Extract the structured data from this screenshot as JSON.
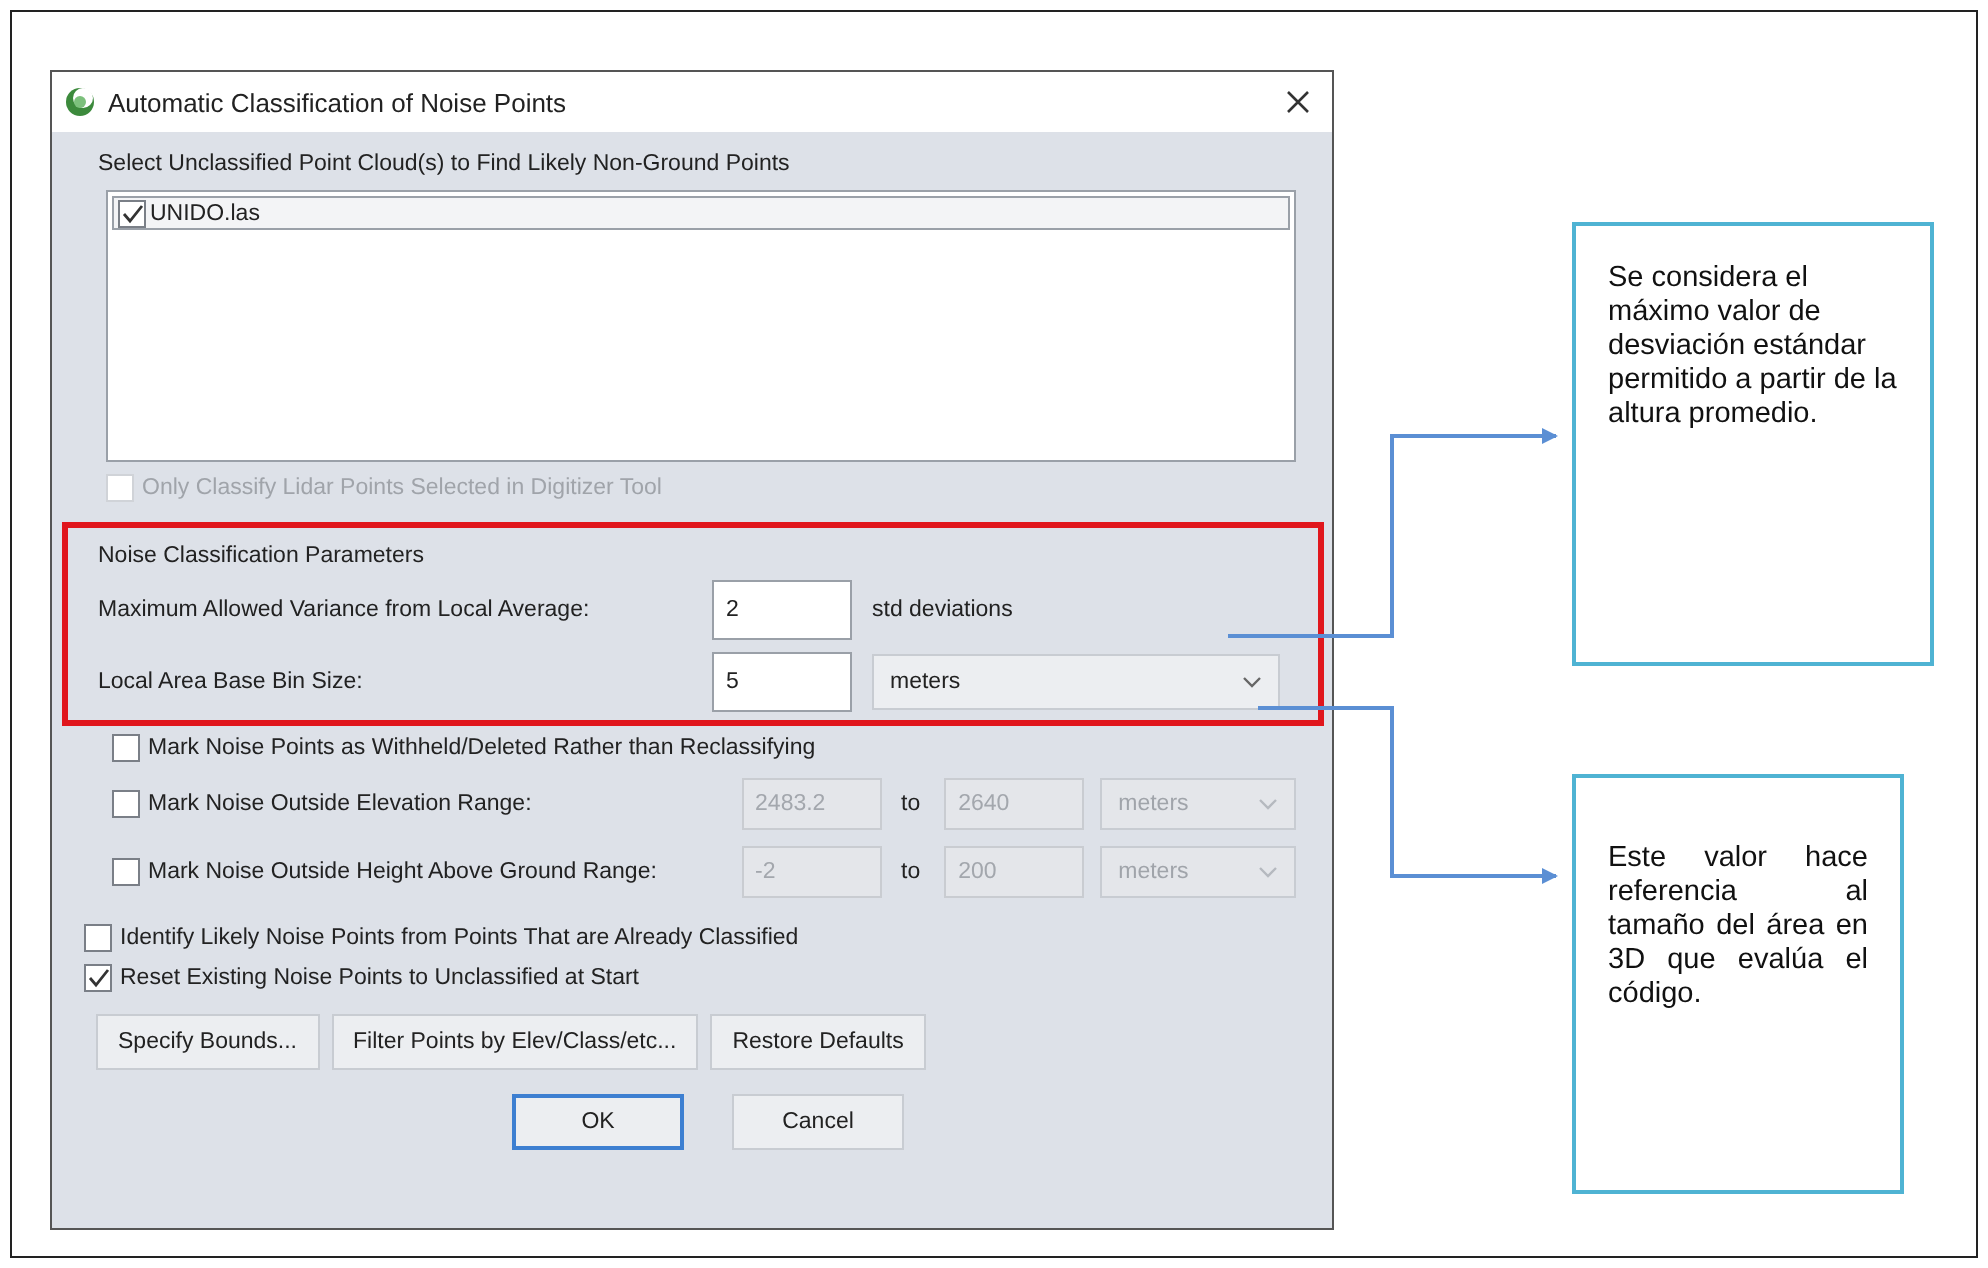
{
  "window": {
    "title": "Automatic Classification of Noise Points"
  },
  "cloud_list": {
    "label": "Select Unclassified Point Cloud(s) to Find Likely Non-Ground Points",
    "items": [
      {
        "name": "UNIDO.las",
        "checked": true,
        "selected": true
      }
    ]
  },
  "selected_only": {
    "label": "Only Classify Lidar Points Selected in Digitizer Tool",
    "checked": false,
    "disabled": true
  },
  "noise_parameters": {
    "heading": "Noise Classification Parameters",
    "rows": [
      {
        "label": "Maximum Allowed Variance from Local Average:",
        "value": "2",
        "unit": "std deviations",
        "kind": "text"
      },
      {
        "label": "Local Area Base Bin Size:",
        "value": "5",
        "unit": "meters",
        "kind": "dropdown"
      }
    ]
  },
  "options": [
    {
      "kind": "checkbox",
      "label": "Mark Noise Points as Withheld/Deleted Rather than Reclassifying",
      "checked": false
    },
    {
      "kind": "range",
      "label": "Mark Noise Outside Elevation Range:",
      "checked": false,
      "from": "2483.2",
      "to_label": "to",
      "to": "2640",
      "unit": "meters"
    },
    {
      "kind": "range",
      "label": "Mark Noise Outside Height Above Ground Range:",
      "checked": false,
      "from": "-2",
      "to_label": "to",
      "to": "200",
      "unit": "meters"
    }
  ],
  "general_options": [
    {
      "label": "Identify Likely Noise Points from Points That are Already Classified",
      "checked": false
    },
    {
      "label": "Reset Existing Noise Points to Unclassified at Start",
      "checked": true
    }
  ],
  "buttons": [
    "Specify Bounds...",
    "Filter Points by Elev/Class/etc...",
    "Restore Defaults"
  ],
  "dialog_buttons": [
    {
      "label": "OK",
      "default": true
    },
    {
      "label": "Cancel",
      "default": false
    }
  ],
  "callouts": [
    {
      "text": "Se considera el máximo valor de desviación estándar permitido a partir de la altura promedio.",
      "justified": false
    },
    {
      "text": "Este valor hace referencia al tamaño del área en 3D que evalúa el código.",
      "justified": true
    }
  ]
}
